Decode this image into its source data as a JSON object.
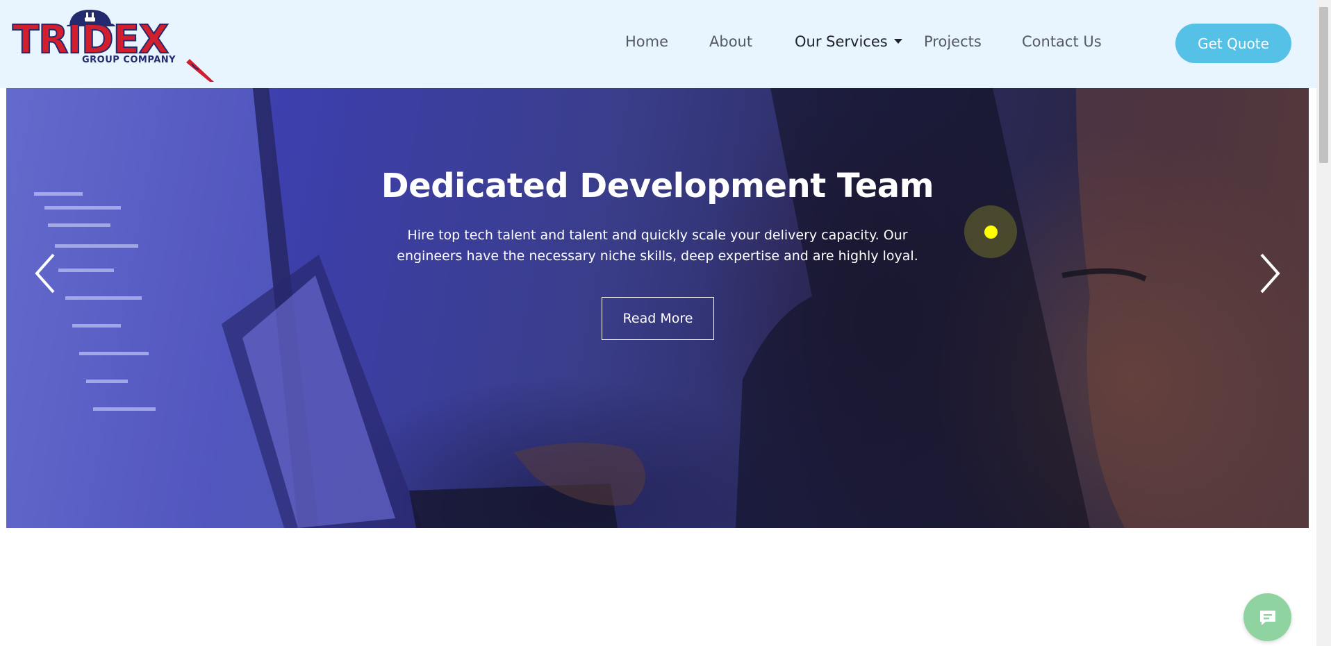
{
  "brand": {
    "name": "TRIDEX",
    "tagline": "GROUP COMPANY",
    "colors": {
      "red": "#d21f2e",
      "navy": "#232a6e"
    }
  },
  "nav": {
    "items": [
      {
        "label": "Home"
      },
      {
        "label": "About"
      },
      {
        "label": "Our Services",
        "has_dropdown": true,
        "active": true
      },
      {
        "label": "Projects"
      },
      {
        "label": "Contact Us"
      }
    ],
    "cta_label": "Get Quote"
  },
  "hero": {
    "title": "Dedicated Development Team",
    "text": "Hire top tech talent and talent and quickly scale your delivery capacity. Our engineers have the necessary niche skills, deep expertise and are highly loyal.",
    "button_label": "Read More",
    "prev_icon": "chevron-left-icon",
    "next_icon": "chevron-right-icon"
  },
  "chat": {
    "icon": "chat-icon",
    "color": "#8fd3a0"
  },
  "theme": {
    "header_bg": "#e8f4fe",
    "cta_bg": "#55c1e6",
    "nav_text": "#555a60"
  }
}
